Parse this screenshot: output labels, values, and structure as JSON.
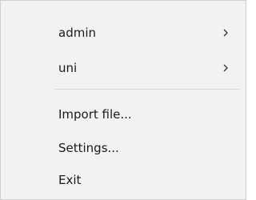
{
  "menu": {
    "items": [
      {
        "label": "admin",
        "submenu": true
      },
      {
        "label": "uni",
        "submenu": true
      },
      {
        "label": "Import file...",
        "submenu": false
      },
      {
        "label": "Settings...",
        "submenu": false
      },
      {
        "label": "Exit",
        "submenu": false
      }
    ]
  },
  "icons": {
    "submenu_arrow": "chevron-right-icon"
  },
  "colors": {
    "menu_background": "#f2f2f2",
    "separator": "#d7d7d7",
    "text": "#1a1a1a"
  }
}
